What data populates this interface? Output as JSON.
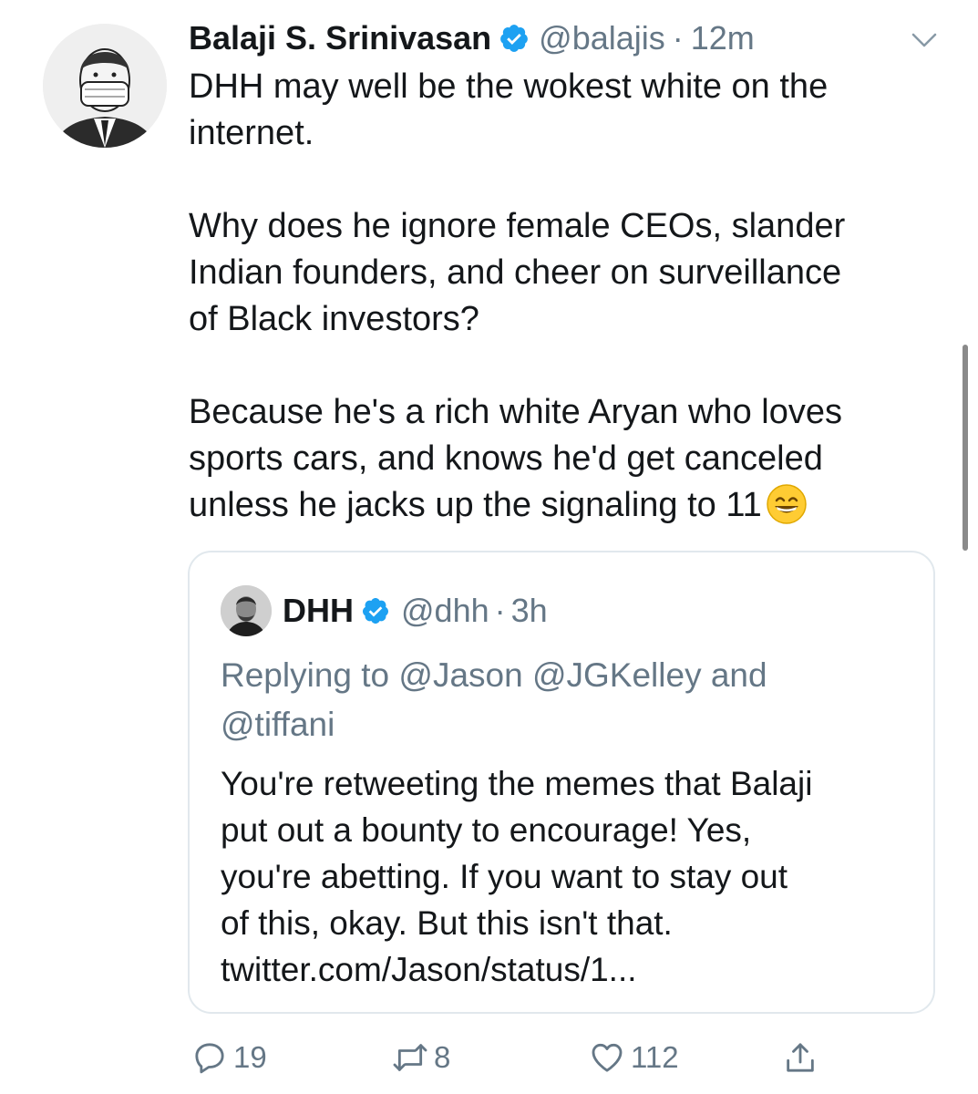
{
  "tweet": {
    "author_name": "Balaji S. Srinivasan",
    "author_handle": "@balajis",
    "separator": "·",
    "time": "12m",
    "text_lines": [
      "DHH may well be the wokest white on the",
      "internet.",
      "",
      "Why does he ignore female CEOs, slander",
      "Indian founders, and cheer on surveillance",
      "of Black investors?",
      "",
      "Because he's a rich white Aryan who loves",
      "sports cars, and knows he'd get canceled",
      "unless he jacks up the signaling to 11"
    ],
    "emoji": "grinning-face-with-smiling-eyes"
  },
  "quoted": {
    "author_name": "DHH",
    "author_handle": "@dhh",
    "separator": "·",
    "time": "3h",
    "reply_lines": [
      "Replying to @Jason @JGKelley and",
      "@tiffani"
    ],
    "text_lines": [
      "You're retweeting the memes that Balaji",
      "put out a bounty to encourage! Yes,",
      "you're abetting. If you want to stay out",
      "of this, okay. But this isn't that.",
      "twitter.com/Jason/status/1..."
    ]
  },
  "actions": {
    "replies": "19",
    "retweets": "8",
    "likes": "112"
  },
  "icons": {
    "verified": "verified-badge-icon",
    "menu": "chevron-down-icon",
    "reply": "reply-icon",
    "retweet": "retweet-icon",
    "like": "heart-icon",
    "share": "share-icon"
  },
  "colors": {
    "verified": "#1da1f2",
    "muted": "#657786",
    "text": "#14171a",
    "border": "#e1e8ed"
  }
}
